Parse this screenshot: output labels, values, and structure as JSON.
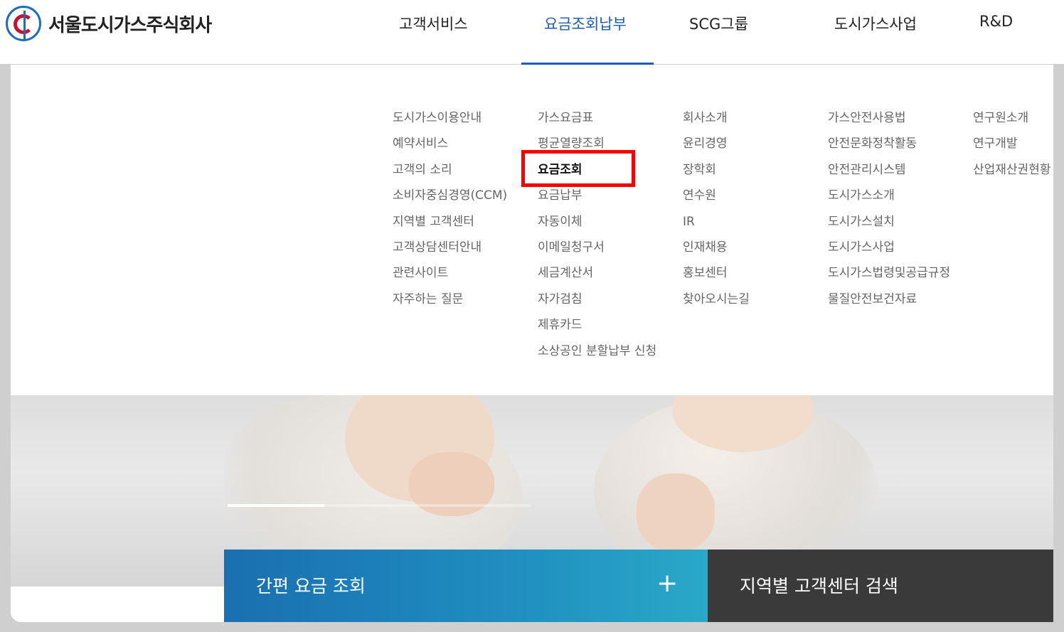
{
  "header": {
    "company_name": "서울도시가스주식회사",
    "nav": [
      {
        "label": "고객서비스"
      },
      {
        "label": "요금조회납부",
        "active": true
      },
      {
        "label": "SCG그룹"
      },
      {
        "label": "도시가스사업"
      },
      {
        "label": "R&D"
      }
    ]
  },
  "mega_menu": {
    "col1": [
      "도시가스이용안내",
      "예약서비스",
      "고객의 소리",
      "소비자중심경영(CCM)",
      "지역별 고객센터",
      "고객상담센터안내",
      "관련사이트",
      "자주하는 질문"
    ],
    "col2": [
      "가스요금표",
      "평균열량조회",
      "요금조회",
      "요금납부",
      "자동이체",
      "이메일청구서",
      "세금계산서",
      "자가검침",
      "제휴카드",
      "소상공인 분할납부 신청"
    ],
    "col3": [
      "회사소개",
      "윤리경영",
      "장학회",
      "연수원",
      "IR",
      "인재채용",
      "홍보센터",
      "찾아오시는길"
    ],
    "col4": [
      "가스안전사용법",
      "안전문화정착활동",
      "안전관리시스템",
      "도시가스소개",
      "도시가스설치",
      "도시가스사업",
      "도시가스법령및공급규정",
      "물질안전보건자료"
    ],
    "col5": [
      "연구원소개",
      "연구개발",
      "산업재산권현황"
    ],
    "selected_item": "요금조회"
  },
  "quick_links": {
    "fee_lookup": "간편 요금 조회",
    "plus_symbol": "+",
    "center_search": "지역별 고객센터 검색"
  },
  "colors": {
    "accent": "#1a5fb4",
    "highlight_box": "#ff0000",
    "quick_gradient_start": "#1a6fb0",
    "quick_gradient_end": "#2aa8c8",
    "center_bg": "#3a3a3a"
  },
  "slider": {
    "active_index": 0,
    "count": 3
  }
}
